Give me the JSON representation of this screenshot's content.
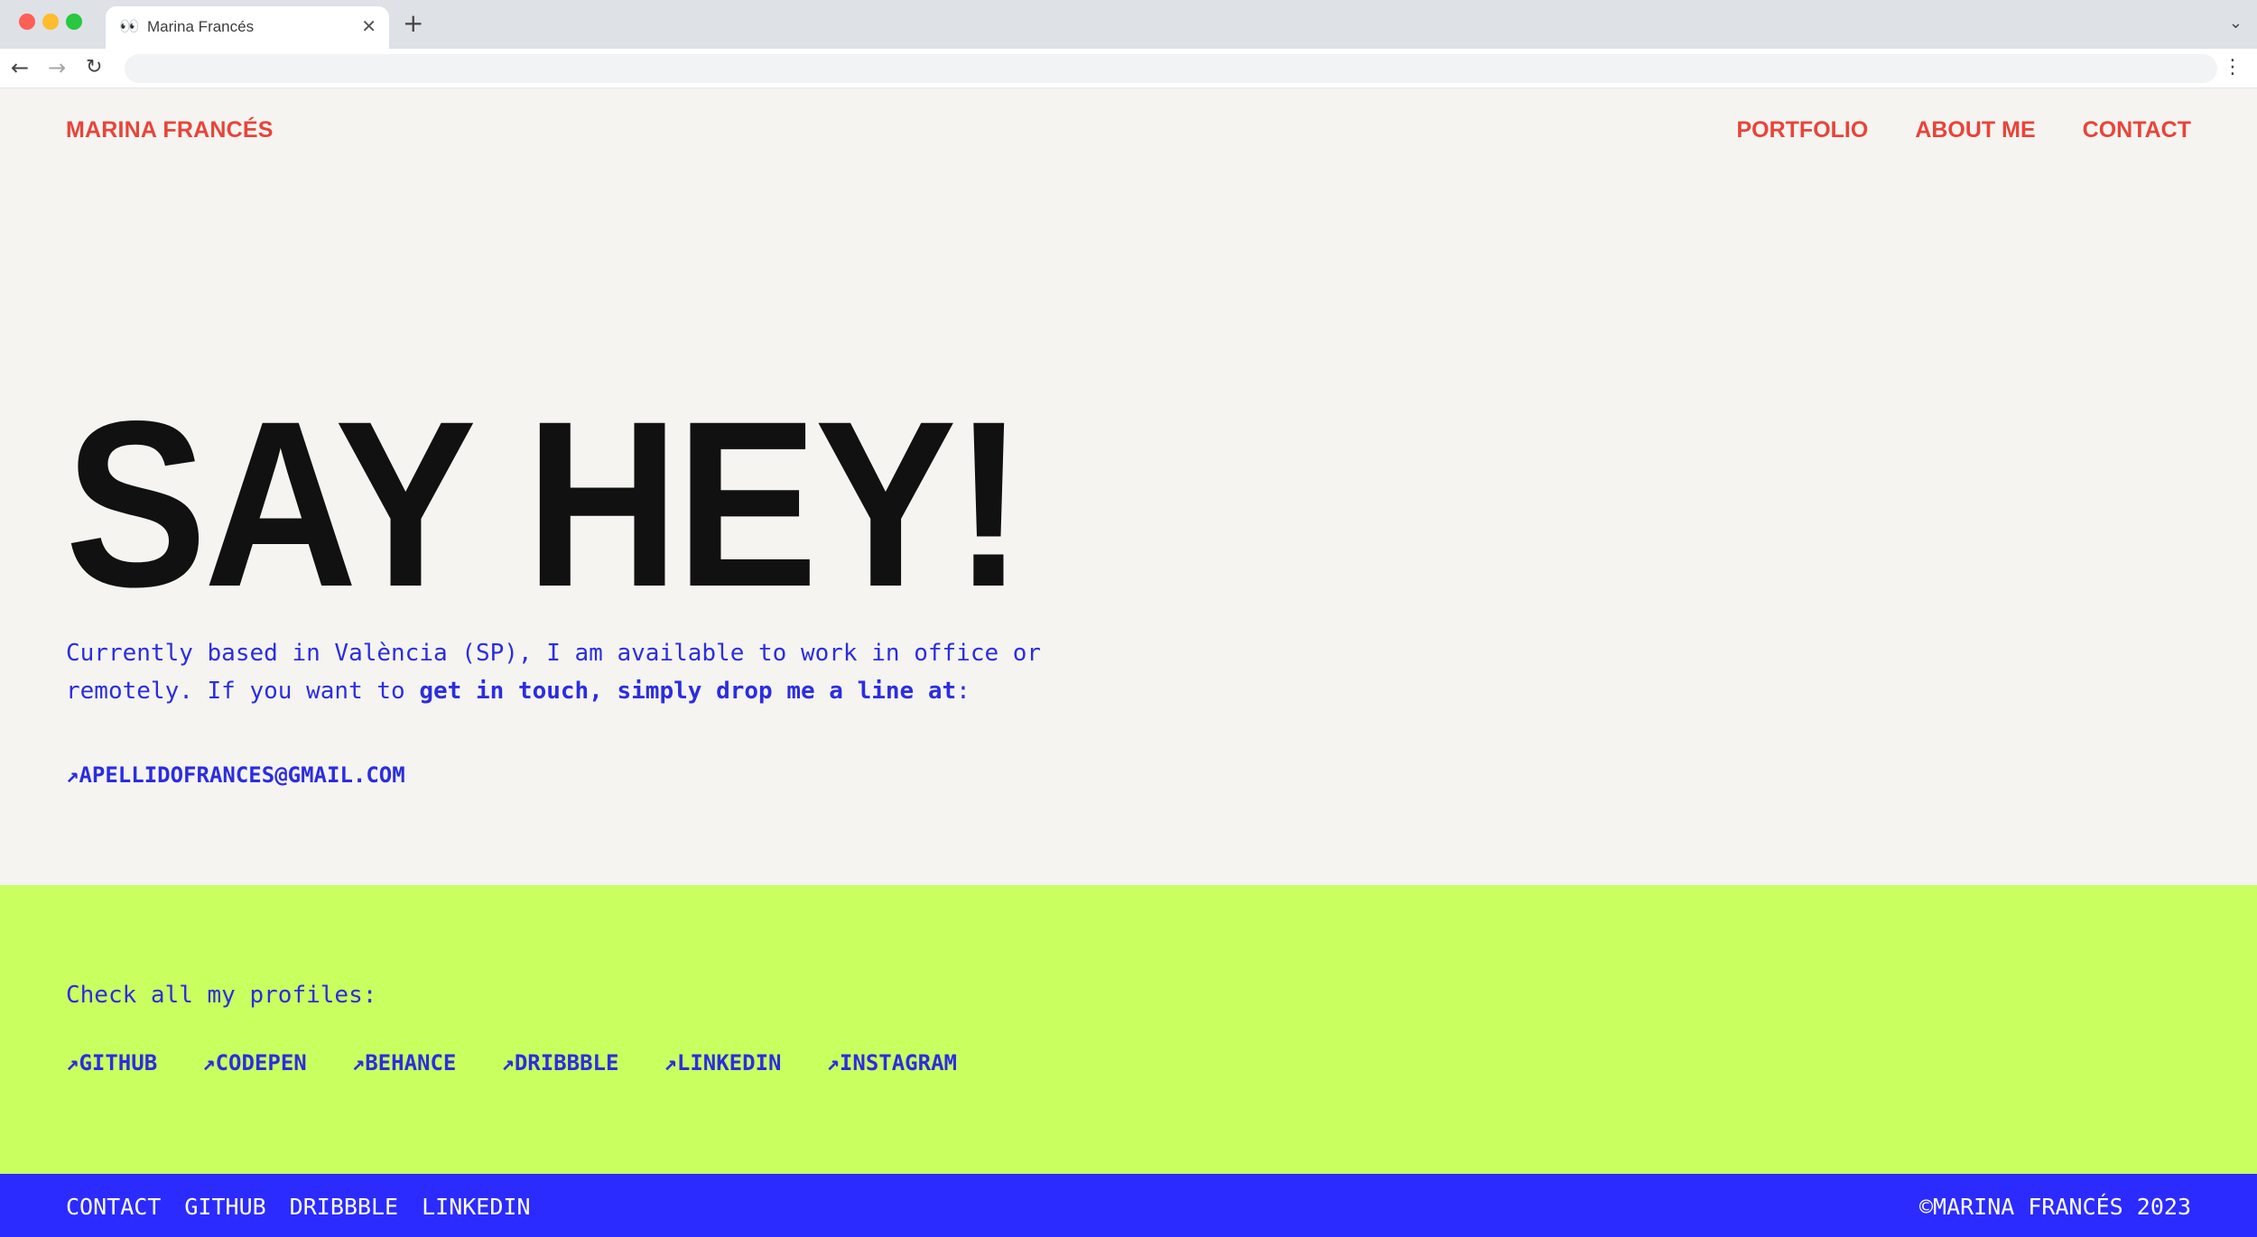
{
  "browser": {
    "tab_favicon": "👀",
    "tab_title": "Marina Francés",
    "tab_close": "✕",
    "new_tab": "+",
    "tab_menu": "⌄",
    "back": "←",
    "forward": "→",
    "reload": "↻",
    "address_value": "",
    "menu": "⋮"
  },
  "header": {
    "brand": "MARINA FRANCÉS",
    "nav": [
      "PORTFOLIO",
      "ABOUT ME",
      "CONTACT"
    ]
  },
  "hero": {
    "title": "SAY HEY!",
    "intro_plain_1": "Currently based in València (SP), I am available to work in office or remotely. If you want to ",
    "intro_bold": "get in touch, simply drop me a line at",
    "intro_plain_2": ":",
    "arrow": "↗",
    "email": "APELLIDOFRANCES@GMAIL.COM"
  },
  "profiles": {
    "label": "Check all my profiles:",
    "links": [
      "GITHUB",
      "CODEPEN",
      "BEHANCE",
      "DRIBBBLE",
      "LINKEDIN",
      "INSTAGRAM"
    ]
  },
  "footer": {
    "links": [
      "CONTACT",
      "GITHUB",
      "DRIBBBLE",
      "LINKEDIN"
    ],
    "copyright": "©MARINA FRANCÉS 2023"
  },
  "colors": {
    "accent_red": "#e8443a",
    "accent_blue": "#2b2de0",
    "lime": "#c9ff5f",
    "footer_blue": "#2b2bff",
    "background": "#f5f4f0"
  }
}
